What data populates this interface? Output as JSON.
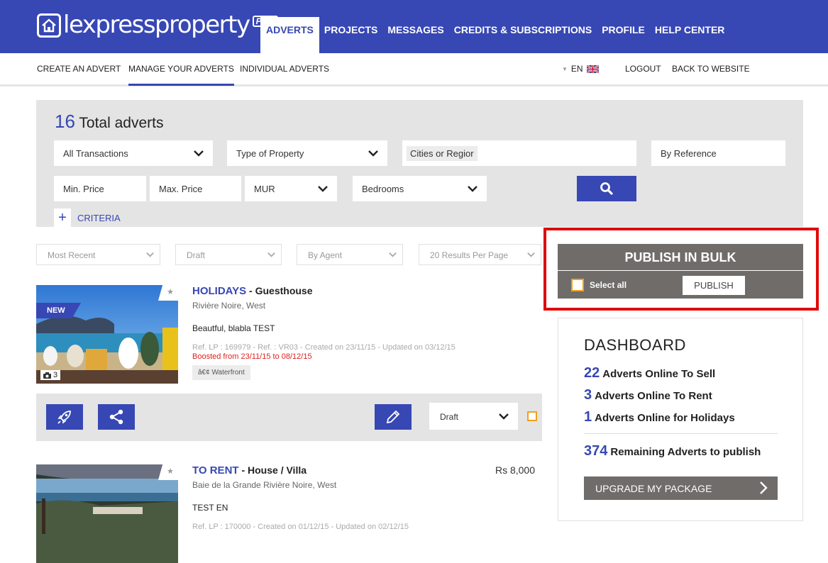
{
  "brand": {
    "logo_text": "lexpressproperty",
    "logo_badge": "PRO"
  },
  "main_nav": [
    "ADVERTS",
    "PROJECTS",
    "MESSAGES",
    "CREDITS & SUBSCRIPTIONS",
    "PROFILE",
    "HELP CENTER"
  ],
  "sub_nav": {
    "create": "CREATE AN ADVERT",
    "manage": "MANAGE YOUR ADVERTS",
    "individual": "INDIVIDUAL ADVERTS",
    "language": "EN",
    "logout": "LOGOUT",
    "back": "BACK TO WEBSITE"
  },
  "search": {
    "count": "16",
    "count_label": "Total adverts",
    "transaction": "All Transactions",
    "property_type": "Type of Property",
    "cities": "Cities or Regior",
    "reference": "By Reference",
    "min_price": "Min. Price",
    "max_price": "Max. Price",
    "currency": "MUR",
    "bedrooms": "Bedrooms",
    "criteria": "CRITERIA"
  },
  "filters": {
    "sort": "Most Recent",
    "status": "Draft",
    "agent": "By Agent",
    "per_page": "20 Results Per Page"
  },
  "listings": [
    {
      "title": "HOLIDAYS",
      "kind": "Guesthouse",
      "location": "Rivière Noire, West",
      "description": "Beautful, blabla TEST",
      "ref": "Ref. LP : 169979 - Ref. : VR03 - Created on 23/11/15 - Updated on 03/12/15",
      "boost": "Boosted from 23/11/15 to 08/12/15",
      "feature": "â€¢ Waterfront",
      "badge": "NEW",
      "photos": "3",
      "price": ""
    },
    {
      "title": "TO RENT",
      "kind": "House / Villa",
      "location": "Baie de la Grande Rivière Noire, West",
      "description": "TEST EN",
      "ref": "Ref. LP : 170000 - Created on 01/12/15 - Updated on 02/12/15",
      "price": "Rs 8,000"
    }
  ],
  "actions": {
    "status": "Draft"
  },
  "bulk": {
    "title": "PUBLISH IN BULK",
    "select_all": "Select all",
    "publish": "PUBLISH"
  },
  "dashboard": {
    "title": "DASHBOARD",
    "sell_count": "22",
    "sell_label": "Adverts Online To Sell",
    "rent_count": "3",
    "rent_label": "Adverts Online To Rent",
    "holiday_count": "1",
    "holiday_label": "Adverts Online for Holidays",
    "remaining_count": "374",
    "remaining_label": "Remaining Adverts to publish",
    "upgrade": "UPGRADE MY PACKAGE"
  },
  "colors": {
    "primary": "#3747b4",
    "grey_panel": "#e4e4e4",
    "dark_grey": "#6f6c6a",
    "highlight": "#e00b0b",
    "checkbox": "#f0a020",
    "boost": "#e0201c"
  }
}
